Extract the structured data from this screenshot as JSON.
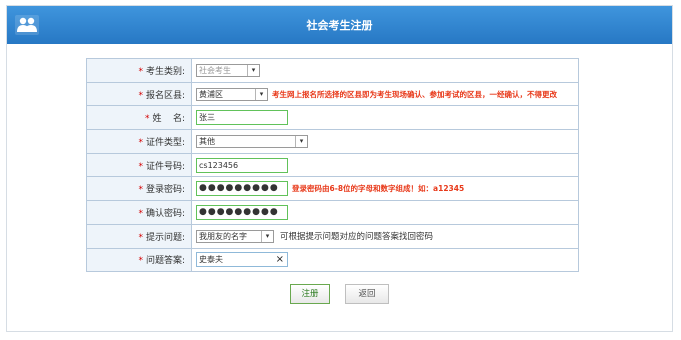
{
  "header": {
    "title": "社会考生注册",
    "icon": "users-icon",
    "color": "#3a8ad6"
  },
  "form": {
    "rows": [
      {
        "label": "考生类别:",
        "control": "select",
        "value": "社会考生",
        "disabled": true
      },
      {
        "label": "报名区县:",
        "control": "select",
        "value": "黄浦区",
        "note": "考生网上报名所选择的区县即为考生现场确认、参加考试的区县，一经确认，不得更改"
      },
      {
        "label": "姓    名:",
        "control": "input",
        "value": "张三"
      },
      {
        "label": "证件类型:",
        "control": "select",
        "value": "其他"
      },
      {
        "label": "证件号码:",
        "control": "input",
        "value": "cs123456"
      },
      {
        "label": "登录密码:",
        "control": "password",
        "value": "●●●●●●●●●",
        "note": "登录密码由6-8位的字母和数字组成！如：a12345"
      },
      {
        "label": "确认密码:",
        "control": "password",
        "value": "●●●●●●●●●"
      },
      {
        "label": "提示问题:",
        "control": "select",
        "value": "我朋友的名字",
        "note": "可根据提示问题对应的问题答案找回密码"
      },
      {
        "label": "问题答案:",
        "control": "input",
        "value": "史泰夫",
        "clear": "×"
      }
    ],
    "required_mark": "*"
  },
  "buttons": {
    "register": "注册",
    "back": "返回"
  }
}
